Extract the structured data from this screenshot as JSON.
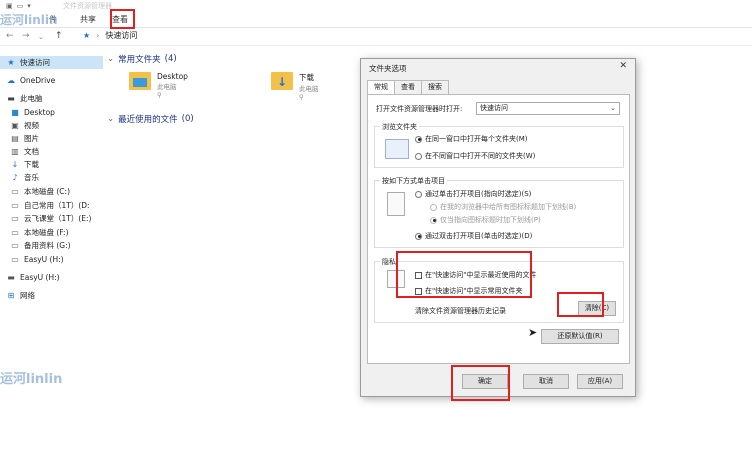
{
  "explorer": {
    "window_title": "文件资源管理器",
    "tabs": [
      "件",
      "共享",
      "查看"
    ],
    "address": {
      "path": "快速访问"
    },
    "sidebar": [
      {
        "label": "快速访问",
        "icon": "star-icon"
      },
      {
        "label": "OneDrive",
        "icon": "cloud-icon"
      },
      {
        "label": "此电脑",
        "icon": "pc-icon"
      },
      {
        "label": "Desktop",
        "icon": "desktop-icon"
      },
      {
        "label": "视频",
        "icon": "video-icon"
      },
      {
        "label": "图片",
        "icon": "picture-icon"
      },
      {
        "label": "文档",
        "icon": "document-icon"
      },
      {
        "label": "下载",
        "icon": "download-icon"
      },
      {
        "label": "音乐",
        "icon": "music-icon"
      },
      {
        "label": "本地磁盘 (C:)",
        "icon": "drive-icon"
      },
      {
        "label": "自己常用（1T）(D:",
        "icon": "drive-icon"
      },
      {
        "label": "云飞课堂（1T）(E:)",
        "icon": "drive-icon"
      },
      {
        "label": "本地磁盘 (F:)",
        "icon": "drive-icon"
      },
      {
        "label": "备用资料 (G:)",
        "icon": "drive-icon"
      },
      {
        "label": "EasyU (H:)",
        "icon": "drive-icon"
      },
      {
        "label": "EasyU (H:)",
        "icon": "usb-icon"
      },
      {
        "label": "网络",
        "icon": "network-icon"
      }
    ],
    "groups": {
      "frequent": {
        "label": "常用文件夹",
        "count": "(4)"
      },
      "recent": {
        "label": "最近使用的文件",
        "count": "(0)"
      }
    },
    "folders": [
      {
        "name": "Desktop",
        "sub": "此电脑"
      },
      {
        "name": "下载",
        "sub": "此电脑"
      }
    ],
    "watermark_top": "运河linlin",
    "watermark_mid": "运河linlin"
  },
  "dialog": {
    "title": "文件夹选项",
    "close": "✕",
    "tabs": [
      "常规",
      "查看",
      "搜索"
    ],
    "open_in_label": "打开文件资源管理器时打开:",
    "open_in_value": "快速访问",
    "browse": {
      "legend": "浏览文件夹",
      "opt1": "在同一窗口中打开每个文件夹(M)",
      "opt2": "在不同窗口中打开不同的文件夹(W)"
    },
    "click": {
      "legend": "按如下方式单击项目",
      "opt1": "通过单击打开项目(指向时选定)(S)",
      "sub1": "在我的浏览器中给所有图标标题加下划线(B)",
      "sub2": "仅当指向图标标题时加下划线(P)",
      "opt2": "通过双击打开项目(单击时选定)(D)"
    },
    "privacy": {
      "legend": "隐私",
      "chk1": "在\"快速访问\"中显示最近使用的文件",
      "chk2": "在\"快速访问\"中显示常用文件夹",
      "clear_label": "清除文件资源管理器历史记录",
      "clear_button": "清除(C)"
    },
    "restore_button": "还原默认值(R)",
    "ok_button": "确定",
    "cancel_button": "取消",
    "apply_button": "应用(A)"
  }
}
